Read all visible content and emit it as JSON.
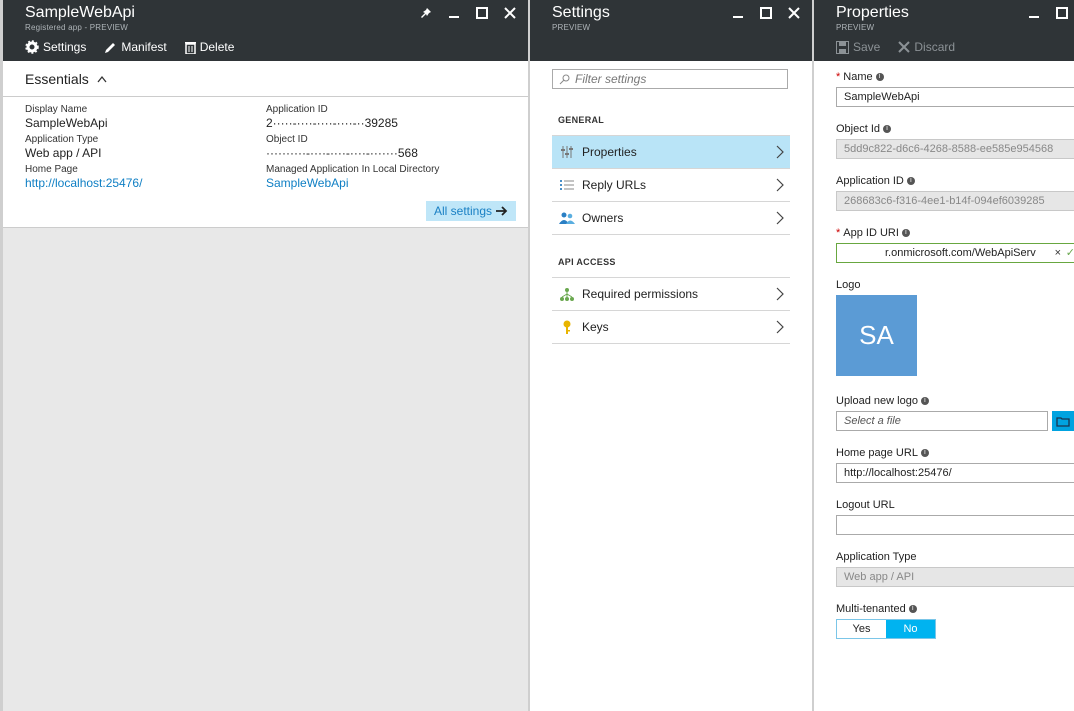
{
  "blade1": {
    "title": "SampleWebApi",
    "subtitle": "Registered app - PREVIEW",
    "toolbar": {
      "settings": "Settings",
      "manifest": "Manifest",
      "delete": "Delete"
    },
    "essentials": {
      "heading": "Essentials",
      "display_name_label": "Display Name",
      "display_name": "SampleWebApi",
      "app_type_label": "Application Type",
      "app_type": "Web app / API",
      "home_page_label": "Home Page",
      "home_page": "http://localhost:25476/",
      "app_id_label": "Application ID",
      "app_id": "2·····-····-····-····-··39285",
      "object_id_label": "Object ID",
      "object_id": "··········-····-····-····-·······568",
      "managed_label": "Managed Application In Local Directory",
      "managed_value": "SampleWebApi",
      "all_settings": "All settings"
    }
  },
  "blade2": {
    "title": "Settings",
    "subtitle": "PREVIEW",
    "filter_placeholder": "Filter settings",
    "general_header": "GENERAL",
    "general_items": [
      "Properties",
      "Reply URLs",
      "Owners"
    ],
    "api_header": "API ACCESS",
    "api_items": [
      "Required permissions",
      "Keys"
    ]
  },
  "blade3": {
    "title": "Properties",
    "subtitle": "PREVIEW",
    "toolbar": {
      "save": "Save",
      "discard": "Discard"
    },
    "name_label": "Name",
    "name_value": "SampleWebApi",
    "object_id_label": "Object Id",
    "object_id_value": "5dd9c822-d6c6-4268-8588-ee585e954568",
    "app_id_label": "Application ID",
    "app_id_value": "268683c6-f316-4ee1-b14f-094ef6039285",
    "app_id_uri_label": "App ID URI",
    "app_id_uri_value": "r.onmicrosoft.com/WebApiServ",
    "logo_label": "Logo",
    "logo_initials": "SA",
    "upload_label": "Upload new logo",
    "upload_placeholder": "Select a file",
    "home_page_label": "Home page URL",
    "home_page_value": "http://localhost:25476/",
    "logout_label": "Logout URL",
    "logout_value": "",
    "app_type_label": "Application Type",
    "app_type_value": "Web app / API",
    "multi_label": "Multi-tenanted",
    "yes": "Yes",
    "no": "No"
  },
  "colors": {
    "header": "#2f3437",
    "accent": "#00b3f0",
    "link": "#0f7fc4",
    "selected": "#b9e4f7"
  }
}
